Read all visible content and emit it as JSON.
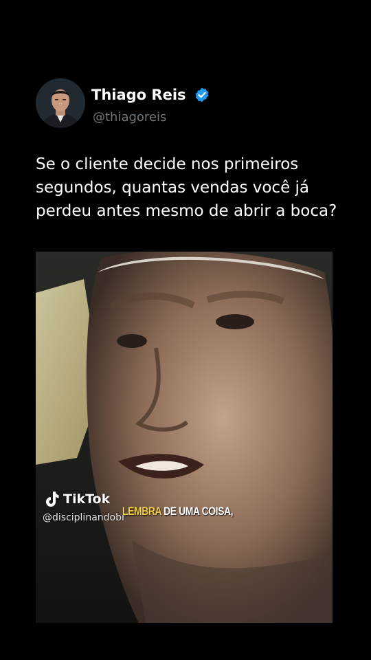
{
  "author": {
    "name": "Thiago Reis",
    "handle": "@thiagoreis",
    "verified_icon": "verified-badge-icon",
    "accent_color": "#1d9bf0"
  },
  "tweet": {
    "text": "Se o cliente decide nos primeiros segundos, quantas vendas você já perdeu antes mesmo de abrir a boca?"
  },
  "media": {
    "watermark_brand": "TikTok",
    "watermark_user": "@disciplinandobr",
    "caption_highlight": "LEMBRA",
    "caption_rest": " DE UMA COISA,",
    "caption_highlight_color": "#f2d03b"
  }
}
